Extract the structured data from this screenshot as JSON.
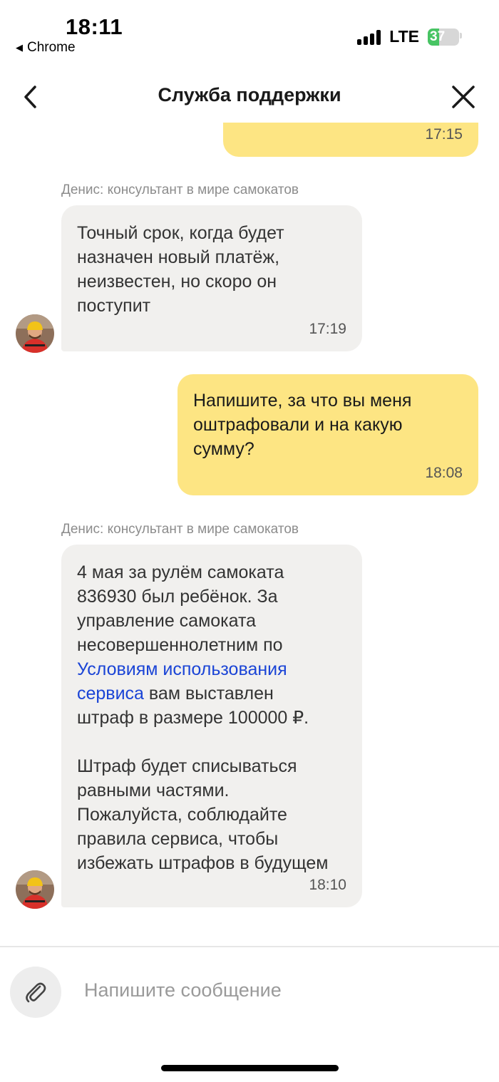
{
  "status_bar": {
    "time": "18:11",
    "back_app": "Chrome",
    "network": "LTE",
    "battery": "37",
    "battery_level": 0.37
  },
  "header": {
    "title": "Служба поддержки"
  },
  "messages": [
    {
      "from": "me",
      "time": "17:15"
    },
    {
      "from": "bot",
      "sender": "Денис: консультант в мире самокатов",
      "text": "Точный срок, когда будет\nназначен новый платёж,\nнеизвестен, но скоро он\nпоступит",
      "time": "17:19"
    },
    {
      "from": "me",
      "text": "Напишите, за что вы меня\nоштрафовали и на какую\nсумму?",
      "time": "18:08"
    },
    {
      "from": "bot",
      "sender": "Денис: консультант в мире самокатов",
      "text_before": "4 мая за рулём самоката\n836930 был ребёнок. За\nуправление самоката\nнесовершеннолетним по",
      "link_part1": "Условиям использования",
      "link_part2": "сервиса",
      "text_after_link": " вам выставлен",
      "text_tail": "штраф в размере 100000 ₽.\n\nШтраф будет списываться\nравными частями.\nПожалуйста, соблюдайте\nправила сервиса, чтобы\nизбежать штрафов в будущем",
      "time": "18:10"
    }
  ],
  "composer": {
    "placeholder": "Напишите сообщение"
  },
  "colors": {
    "my_bubble": "#fde583",
    "bot_bubble": "#f1f0ee",
    "link": "#1a44d6"
  }
}
